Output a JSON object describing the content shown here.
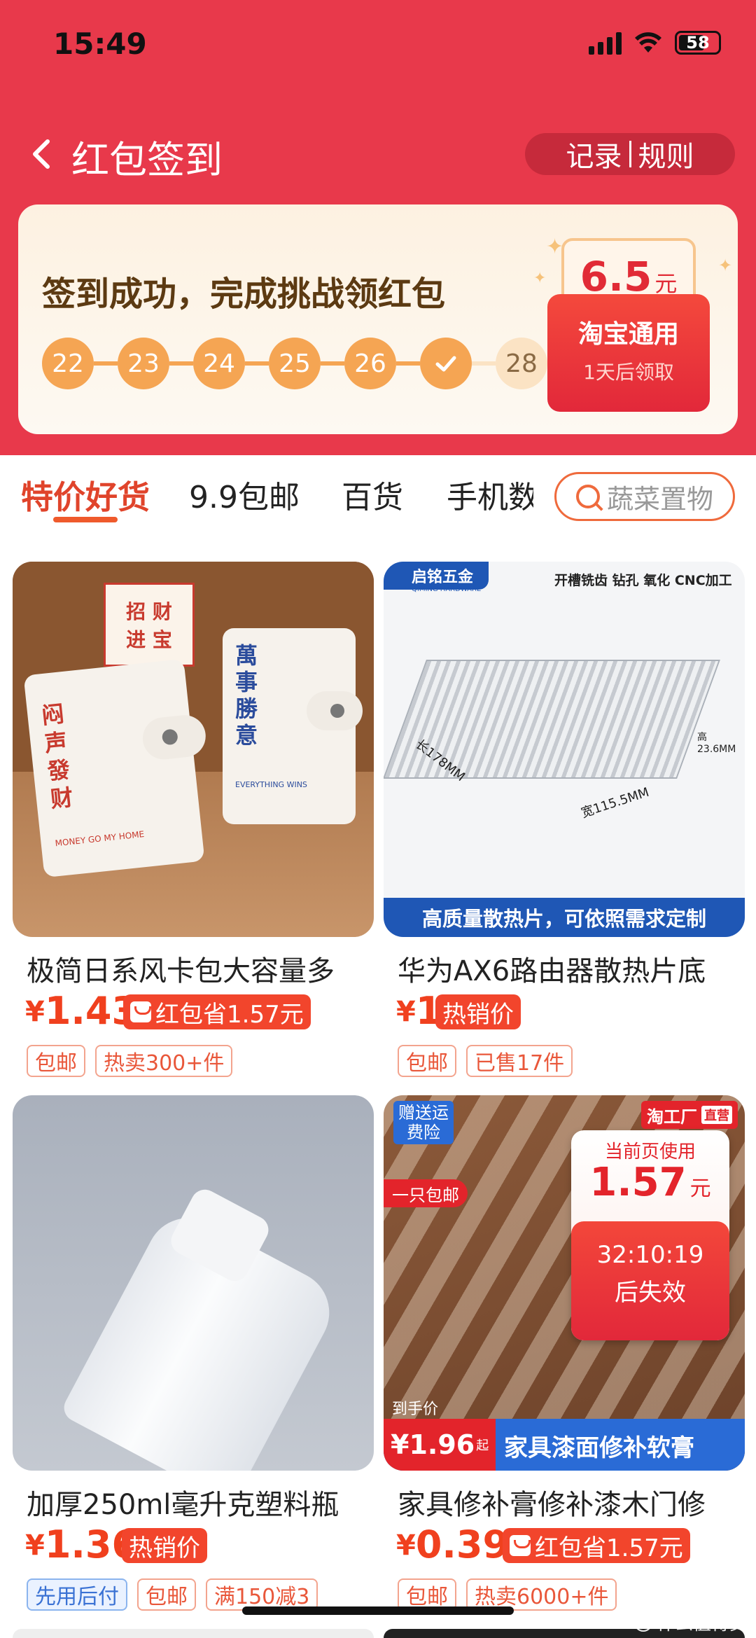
{
  "status_bar": {
    "time": "15:49",
    "battery": "58"
  },
  "nav": {
    "title": "红包签到",
    "record": "记录",
    "rules": "规则"
  },
  "checkin": {
    "message": "签到成功，完成挑战领红包",
    "days": [
      "22",
      "23",
      "24",
      "25",
      "26",
      "",
      "28"
    ],
    "coupon": {
      "amount": "6.5",
      "unit": "元",
      "line1": "淘宝通用",
      "line2": "1天后领取"
    }
  },
  "tabs": [
    "特价好货",
    "9.9包邮",
    "百货",
    "手机数"
  ],
  "search": {
    "placeholder": "蔬菜置物"
  },
  "products": [
    {
      "title": "极简日系风卡包大容量多",
      "price": "1.43",
      "badge": "红包省1.57元",
      "tags": [
        "包邮",
        "热卖300+件"
      ],
      "img_texts": {
        "t1": "招 财",
        "t2": "进 宝",
        "t3": "闷 声 發 财",
        "t4": "萬 事 勝 意",
        "t5": "MONEY GO MY HOME",
        "t6": "EVERYTHING WINS"
      }
    },
    {
      "title": "华为AX6路由器散热片底",
      "price": "1",
      "badge": "热销价",
      "tags": [
        "包邮",
        "已售17件"
      ],
      "img_texts": {
        "brand": "启铭五金",
        "brand_en": "QIMING HARDWARE",
        "process": "开槽铣齿 钻孔 氧化 CNC加工",
        "dim1": "长178MM",
        "dim2": "宽115.5MM",
        "dim3": "高23.6MM",
        "banner": "高质量散热片，可依照需求定制"
      }
    },
    {
      "title": "加厚250ml毫升克塑料瓶",
      "price": "1.36",
      "badge": "热销价",
      "tags": [
        "先用后付",
        "包邮",
        "满150减3"
      ]
    },
    {
      "title": "家具修补膏修补漆木门修",
      "price": "0.39",
      "badge": "红包省1.57元",
      "tags": [
        "包邮",
        "热卖6000+件"
      ],
      "img_texts": {
        "gift": "赠送运费险",
        "factory": "淘工厂",
        "direct": "直营",
        "ship": "一只包邮",
        "hand_price": "到手价",
        "hand_val": "¥1.96",
        "qi": "起",
        "banner": "家具漆面修补软膏"
      },
      "overlay": {
        "label": "当前页使用",
        "amount": "1.57",
        "unit": "元",
        "countdown": "32:10:19",
        "expire": "后失效"
      }
    }
  ],
  "watermark": "什么值得买"
}
